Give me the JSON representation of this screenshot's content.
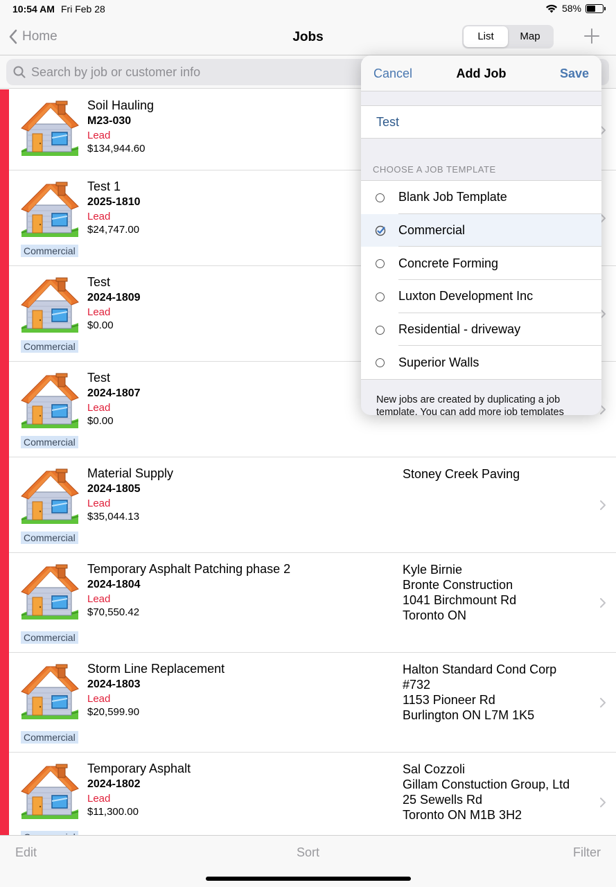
{
  "status": {
    "time": "10:54 AM",
    "date": "Fri Feb 28",
    "battery": "58%",
    "battery_level": 0.58
  },
  "nav": {
    "back": "Home",
    "title": "Jobs",
    "segments": [
      "List",
      "Map"
    ],
    "active_segment": "List"
  },
  "search": {
    "placeholder": "Search by job or customer info"
  },
  "jobs": [
    {
      "name": "Soil Hauling",
      "number": "M23-030",
      "status": "Lead",
      "amount": "$134,944.60",
      "tag": "",
      "customer": []
    },
    {
      "name": "Test 1",
      "number": "2025-1810",
      "status": "Lead",
      "amount": "$24,747.00",
      "tag": "Commercial",
      "customer": []
    },
    {
      "name": "Test",
      "number": "2024-1809",
      "status": "Lead",
      "amount": "$0.00",
      "tag": "Commercial",
      "customer": []
    },
    {
      "name": "Test",
      "number": "2024-1807",
      "status": "Lead",
      "amount": "$0.00",
      "tag": "Commercial",
      "customer": []
    },
    {
      "name": "Material Supply",
      "number": "2024-1805",
      "status": "Lead",
      "amount": "$35,044.13",
      "tag": "Commercial",
      "customer": [
        "Stoney Creek Paving"
      ]
    },
    {
      "name": "Temporary Asphalt Patching phase 2",
      "number": "2024-1804",
      "status": "Lead",
      "amount": "$70,550.42",
      "tag": "Commercial",
      "customer": [
        "Kyle  Birnie",
        "Bronte Construction",
        "1041 Birchmount Rd",
        "Toronto ON"
      ]
    },
    {
      "name": "Storm Line Replacement",
      "number": "2024-1803",
      "status": "Lead",
      "amount": "$20,599.90",
      "tag": "Commercial",
      "customer": [
        "Halton Standard Cond Corp",
        "#732",
        "1153 Pioneer Rd",
        "Burlington ON L7M 1K5"
      ]
    },
    {
      "name": "Temporary Asphalt",
      "number": "2024-1802",
      "status": "Lead",
      "amount": "$11,300.00",
      "tag": "Commercial",
      "customer": [
        "Sal Cozzoli",
        "Gillam Constuction Group, Ltd",
        "25 Sewells Rd",
        "Toronto ON M1B 3H2"
      ]
    }
  ],
  "popover": {
    "cancel": "Cancel",
    "title": "Add Job",
    "save": "Save",
    "job_name_value": "Test",
    "section_header": "CHOOSE A JOB TEMPLATE",
    "templates": [
      {
        "label": "Blank Job Template",
        "selected": false
      },
      {
        "label": "Commercial",
        "selected": true
      },
      {
        "label": "Concrete Forming",
        "selected": false
      },
      {
        "label": "Luxton Development Inc",
        "selected": false
      },
      {
        "label": "Residential - driveway",
        "selected": false
      },
      {
        "label": "Superior Walls",
        "selected": false
      }
    ],
    "footer": "New jobs are created by duplicating a job template. You can add more job templates"
  },
  "toolbar": {
    "edit": "Edit",
    "sort": "Sort",
    "filter": "Filter"
  },
  "colors": {
    "accent": "#4a78b0",
    "lead": "#e0203a",
    "redbar": "#f22a44",
    "tag_bg": "#d6e5f7"
  },
  "icons": {
    "back": "chevron-left-icon",
    "add": "plus-icon",
    "search": "search-icon",
    "job": "house-icon",
    "row": "chevron-right-icon",
    "selected": "checkmark-circle-icon"
  }
}
